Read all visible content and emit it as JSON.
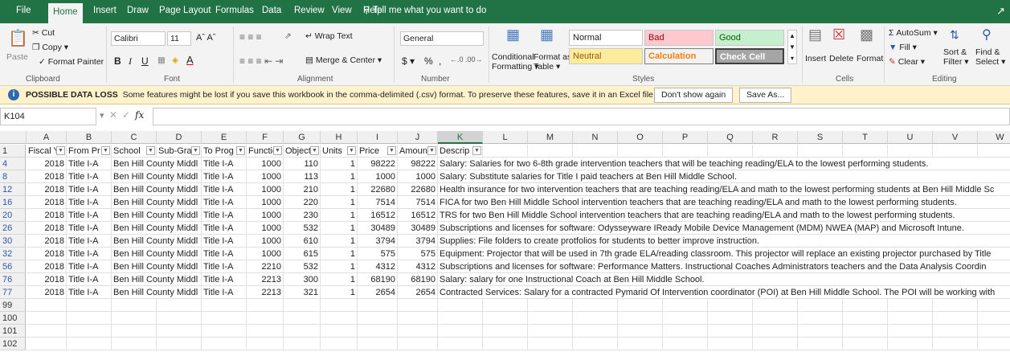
{
  "tabs": [
    "File",
    "Home",
    "Insert",
    "Draw",
    "Page Layout",
    "Formulas",
    "Data",
    "Review",
    "View",
    "Help"
  ],
  "tell_me": "Tell me what you want to do",
  "ribbon": {
    "clipboard": {
      "paste": "Paste",
      "cut": "Cut",
      "copy": "Copy",
      "format_painter": "Format Painter",
      "group": "Clipboard"
    },
    "font": {
      "name": "Calibri",
      "size": "11",
      "group": "Font"
    },
    "alignment": {
      "wrap": "Wrap Text",
      "merge": "Merge & Center",
      "group": "Alignment"
    },
    "number": {
      "format": "General",
      "currency": "$",
      "percent": "%",
      "comma": ",",
      "group": "Number"
    },
    "styles": {
      "conditional": "Conditional",
      "conditional2": "Formatting",
      "format_as": "Format as",
      "format_as2": "Table",
      "normal": "Normal",
      "bad": "Bad",
      "good": "Good",
      "neutral": "Neutral",
      "calculation": "Calculation",
      "check": "Check Cell",
      "group": "Styles"
    },
    "cells": {
      "insert": "Insert",
      "delete": "Delete",
      "format": "Format",
      "group": "Cells"
    },
    "editing": {
      "autosum": "AutoSum",
      "fill": "Fill",
      "clear": "Clear",
      "sort": "Sort &",
      "sort2": "Filter",
      "find": "Find &",
      "find2": "Select",
      "group": "Editing"
    }
  },
  "message": {
    "title": "POSSIBLE DATA LOSS",
    "text": "Some features might be lost if you save this workbook in the comma-delimited (.csv) format. To preserve these features, save it in an Excel file format.",
    "dont_show": "Don't show again",
    "save_as": "Save As..."
  },
  "namebox": "K104",
  "columns": [
    "A",
    "B",
    "C",
    "D",
    "E",
    "F",
    "G",
    "H",
    "I",
    "J",
    "K",
    "L",
    "M",
    "N",
    "O",
    "P",
    "Q",
    "R",
    "S",
    "T",
    "U",
    "V",
    "W"
  ],
  "headers": [
    "Fiscal Yi",
    "From Pr",
    "School",
    "Sub-Gra",
    "To Prog",
    "Functio",
    "Object",
    "Units",
    "Price",
    "Amount",
    "Descrip"
  ],
  "rows": [
    {
      "n": "4",
      "a": "2018",
      "b": "Title I-A",
      "c": "Ben Hill County Middl",
      "e": "Title I-A",
      "f": "1000",
      "g": "110",
      "h": "1",
      "i": "98222",
      "j": "98222",
      "k": "Salary:  Salaries for two 6-8th grade intervention teachers that will be teaching reading/ELA to the lowest performing students."
    },
    {
      "n": "8",
      "a": "2018",
      "b": "Title I-A",
      "c": "Ben Hill County Middl",
      "e": "Title I-A",
      "f": "1000",
      "g": "113",
      "h": "1",
      "i": "1000",
      "j": "1000",
      "k": "Salary:  Substitute salaries for Title I paid teachers at Ben Hill Middle School."
    },
    {
      "n": "12",
      "a": "2018",
      "b": "Title I-A",
      "c": "Ben Hill County Middl",
      "e": "Title I-A",
      "f": "1000",
      "g": "210",
      "h": "1",
      "i": "22680",
      "j": "22680",
      "k": "Health insurance for two intervention teachers that are teaching reading/ELA and math to the lowest performing students at Ben Hill Middle Sc"
    },
    {
      "n": "16",
      "a": "2018",
      "b": "Title I-A",
      "c": "Ben Hill County Middl",
      "e": "Title I-A",
      "f": "1000",
      "g": "220",
      "h": "1",
      "i": "7514",
      "j": "7514",
      "k": "FICA for two Ben Hill Middle School intervention teachers that are teaching reading/ELA and math to the lowest performing students."
    },
    {
      "n": "20",
      "a": "2018",
      "b": "Title I-A",
      "c": "Ben Hill County Middl",
      "e": "Title I-A",
      "f": "1000",
      "g": "230",
      "h": "1",
      "i": "16512",
      "j": "16512",
      "k": "TRS for two Ben Hill Middle School intervention teachers that are teaching reading/ELA and math to the lowest performing students."
    },
    {
      "n": "26",
      "a": "2018",
      "b": "Title I-A",
      "c": "Ben Hill County Middl",
      "e": "Title I-A",
      "f": "1000",
      "g": "532",
      "h": "1",
      "i": "30489",
      "j": "30489",
      "k": "Subscriptions and licenses for software:  Odysseyware  IReady  Mobile Device Management (MDM)  NWEA (MAP)  and Microsoft Intune."
    },
    {
      "n": "30",
      "a": "2018",
      "b": "Title I-A",
      "c": "Ben Hill County Middl",
      "e": "Title I-A",
      "f": "1000",
      "g": "610",
      "h": "1",
      "i": "3794",
      "j": "3794",
      "k": "Supplies:  File folders to create protfolios for students to better improve instruction."
    },
    {
      "n": "32",
      "a": "2018",
      "b": "Title I-A",
      "c": "Ben Hill County Middl",
      "e": "Title I-A",
      "f": "1000",
      "g": "615",
      "h": "1",
      "i": "575",
      "j": "575",
      "k": "Equipment:  Projector that will be used in 7th grade ELA/reading classroom.  This projector will replace an existing projector purchased by Title"
    },
    {
      "n": "56",
      "a": "2018",
      "b": "Title I-A",
      "c": "Ben Hill County Middl",
      "e": "Title I-A",
      "f": "2210",
      "g": "532",
      "h": "1",
      "i": "4312",
      "j": "4312",
      "k": "Subscriptions and licenses for software:  Performance Matters.  Instructional Coaches  Administrators  teachers  and the Data Analysis Coordin"
    },
    {
      "n": "76",
      "a": "2018",
      "b": "Title I-A",
      "c": "Ben Hill County Middl",
      "e": "Title I-A",
      "f": "2213",
      "g": "300",
      "h": "1",
      "i": "68190",
      "j": "68190",
      "k": "Salary:  salary for one Instructional Coach at Ben Hill Middle School."
    },
    {
      "n": "77",
      "a": "2018",
      "b": "Title I-A",
      "c": "Ben Hill County Middl",
      "e": "Title I-A",
      "f": "2213",
      "g": "321",
      "h": "1",
      "i": "2654",
      "j": "2654",
      "k": "Contracted Services:  Salary for a contracted Pymarid Of Intervention coordinator (POI) at Ben Hill Middle School.  The POI will be working with"
    }
  ],
  "empty_rows": [
    "99",
    "100",
    "101",
    "102"
  ]
}
